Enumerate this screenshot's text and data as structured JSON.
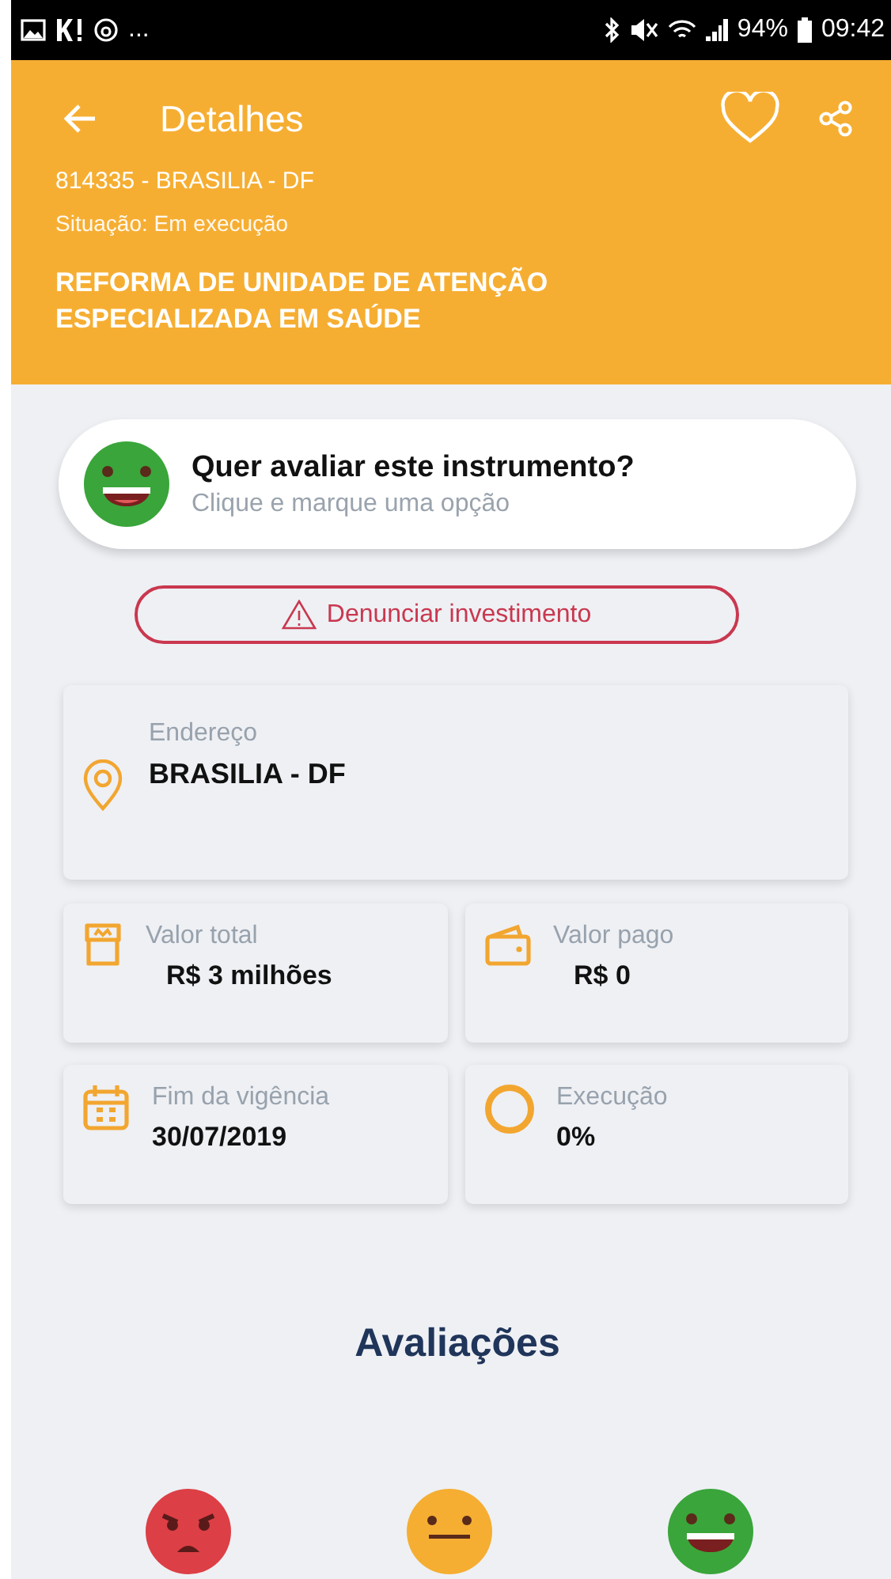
{
  "status_bar": {
    "left_text": "...",
    "battery": "94%",
    "time": "09:42"
  },
  "header": {
    "title": "Detalhes",
    "code_line": "814335 - BRASILIA - DF",
    "status_line": "Situação: Em execução",
    "project_title": "REFORMA DE UNIDADE DE ATENÇÃO ESPECIALIZADA EM SAÚDE"
  },
  "rate_prompt": {
    "title": "Quer avaliar este instrumento?",
    "subtitle": "Clique e marque uma opção"
  },
  "report_button": "Denunciar investimento",
  "address": {
    "label": "Endereço",
    "value": "BRASILIA - DF"
  },
  "info_cards": [
    {
      "kind": "store",
      "label": "Valor total",
      "value": "R$ 3 milhões",
      "centered": true
    },
    {
      "kind": "wallet",
      "label": "Valor pago",
      "value": "R$ 0",
      "centered": true
    },
    {
      "kind": "calendar",
      "label": "Fim da vigência",
      "value": "30/07/2019",
      "centered": false
    },
    {
      "kind": "progress",
      "label": "Execução",
      "value": "0%",
      "centered": false
    }
  ],
  "ratings_title": "Avaliações",
  "ratings": [
    {
      "kind": "angry"
    },
    {
      "kind": "neutral"
    },
    {
      "kind": "happy"
    }
  ]
}
